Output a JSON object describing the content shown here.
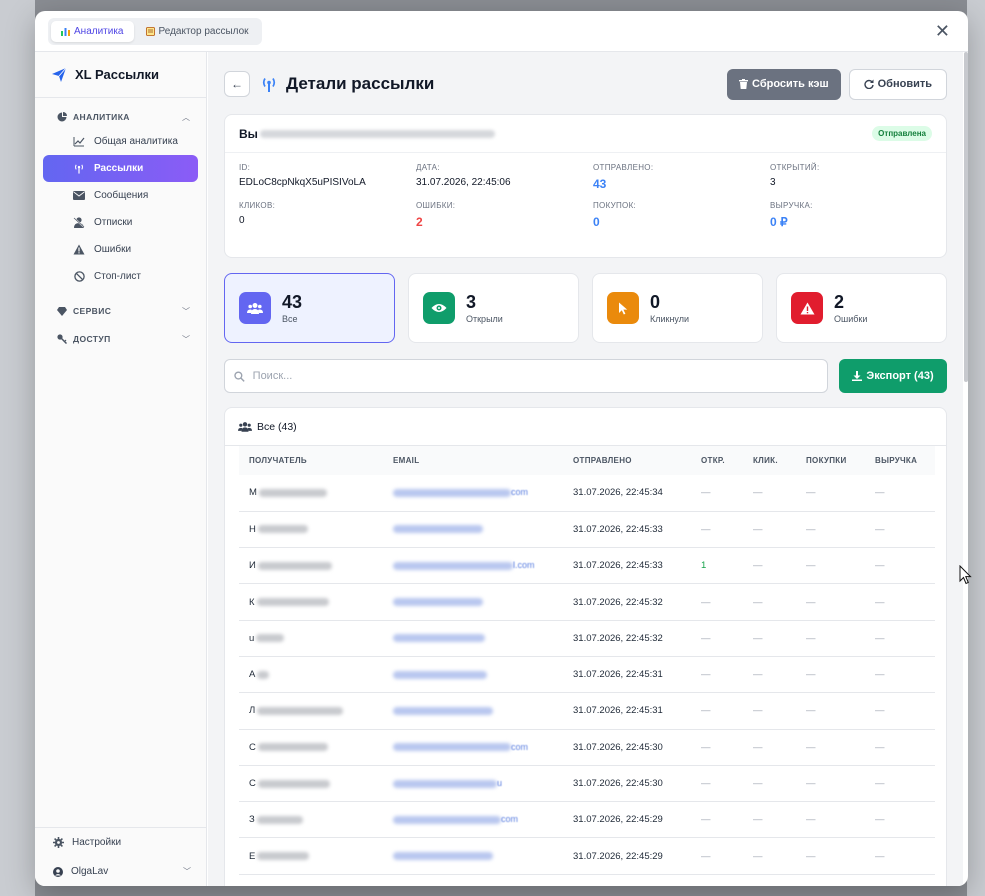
{
  "top_tabs": [
    {
      "label": "Аналитика",
      "active": true
    },
    {
      "label": "Редактор рассылок",
      "active": false
    }
  ],
  "brand": {
    "name": "XL Рассылки"
  },
  "sidebar": {
    "analytics_section": "АНАЛИТИКА",
    "items": [
      {
        "label": "Общая аналитика",
        "icon": "chart-line-icon"
      },
      {
        "label": "Рассылки",
        "icon": "broadcast-icon",
        "active": true
      },
      {
        "label": "Сообщения",
        "icon": "envelope-icon"
      },
      {
        "label": "Отписки",
        "icon": "user-slash-icon"
      },
      {
        "label": "Ошибки",
        "icon": "warning-icon"
      },
      {
        "label": "Стоп-лист",
        "icon": "ban-icon"
      }
    ],
    "service_section": "СЕРВИС",
    "access_section": "ДОСТУП",
    "settings_label": "Настройки",
    "user_label": "OlgaLav"
  },
  "header": {
    "title": "Детали рассылки",
    "reset_cache_label": "Сбросить кэш",
    "refresh_label": "Обновить"
  },
  "info": {
    "subject_visible": "Вы",
    "status": "Отправлена",
    "id_label": "ID:",
    "id_value": "EDLoC8cpNkqX5uPISIVoLA",
    "date_label": "ДАТА:",
    "date_value": "31.07.2026, 22:45:06",
    "sent_label": "ОТПРАВЛЕНО:",
    "sent_value": "43",
    "opens_label": "ОТКРЫТИЙ:",
    "opens_value": "3",
    "clicks_label": "КЛИКОВ:",
    "clicks_value": "0",
    "errors_label": "ОШИБКИ:",
    "errors_value": "2",
    "purchases_label": "ПОКУПОК:",
    "purchases_value": "0",
    "revenue_label": "ВЫРУЧКА:",
    "revenue_value": "0 ₽"
  },
  "stats": [
    {
      "value": "43",
      "label": "Все",
      "color": "#6366f1",
      "icon": "users-icon"
    },
    {
      "value": "3",
      "label": "Открыли",
      "color": "#0f9d6b",
      "icon": "eye-icon"
    },
    {
      "value": "0",
      "label": "Кликнули",
      "color": "#ea8a0c",
      "icon": "pointer-icon"
    },
    {
      "value": "2",
      "label": "Ошибки",
      "color": "#e11d2e",
      "icon": "alert-icon"
    }
  ],
  "search": {
    "placeholder": "Поиск...",
    "export_label": "Экспорт (43)"
  },
  "table": {
    "title": "Все (43)",
    "columns": [
      "ПОЛУЧАТЕЛЬ",
      "EMAIL",
      "ОТПРАВЛЕНО",
      "ОТКР.",
      "КЛИК.",
      "ПОКУПКИ",
      "ВЫРУЧКА"
    ],
    "rows": [
      {
        "name": "M",
        "email": "com",
        "sent": "31.07.2026, 22:45:34",
        "open": "—",
        "click": "—",
        "buy": "—",
        "rev": "—"
      },
      {
        "name": "H",
        "email": "",
        "sent": "31.07.2026, 22:45:33",
        "open": "—",
        "click": "—",
        "buy": "—",
        "rev": "—"
      },
      {
        "name": "И",
        "email": "l.com",
        "sent": "31.07.2026, 22:45:33",
        "open": "1",
        "click": "—",
        "buy": "—",
        "rev": "—"
      },
      {
        "name": "К",
        "email": "",
        "sent": "31.07.2026, 22:45:32",
        "open": "—",
        "click": "—",
        "buy": "—",
        "rev": "—"
      },
      {
        "name": "u",
        "email": "",
        "sent": "31.07.2026, 22:45:32",
        "open": "—",
        "click": "—",
        "buy": "—",
        "rev": "—"
      },
      {
        "name": "A",
        "email": "",
        "sent": "31.07.2026, 22:45:31",
        "open": "—",
        "click": "—",
        "buy": "—",
        "rev": "—"
      },
      {
        "name": "Л",
        "email": "",
        "sent": "31.07.2026, 22:45:31",
        "open": "—",
        "click": "—",
        "buy": "—",
        "rev": "—"
      },
      {
        "name": "C",
        "email": "com",
        "sent": "31.07.2026, 22:45:30",
        "open": "—",
        "click": "—",
        "buy": "—",
        "rev": "—"
      },
      {
        "name": "C",
        "email": "u",
        "sent": "31.07.2026, 22:45:30",
        "open": "—",
        "click": "—",
        "buy": "—",
        "rev": "—"
      },
      {
        "name": "З",
        "email": "com",
        "sent": "31.07.2026, 22:45:29",
        "open": "—",
        "click": "—",
        "buy": "—",
        "rev": "—"
      },
      {
        "name": "E",
        "email": "",
        "sent": "31.07.2026, 22:45:29",
        "open": "—",
        "click": "—",
        "buy": "—",
        "rev": "—"
      }
    ]
  }
}
